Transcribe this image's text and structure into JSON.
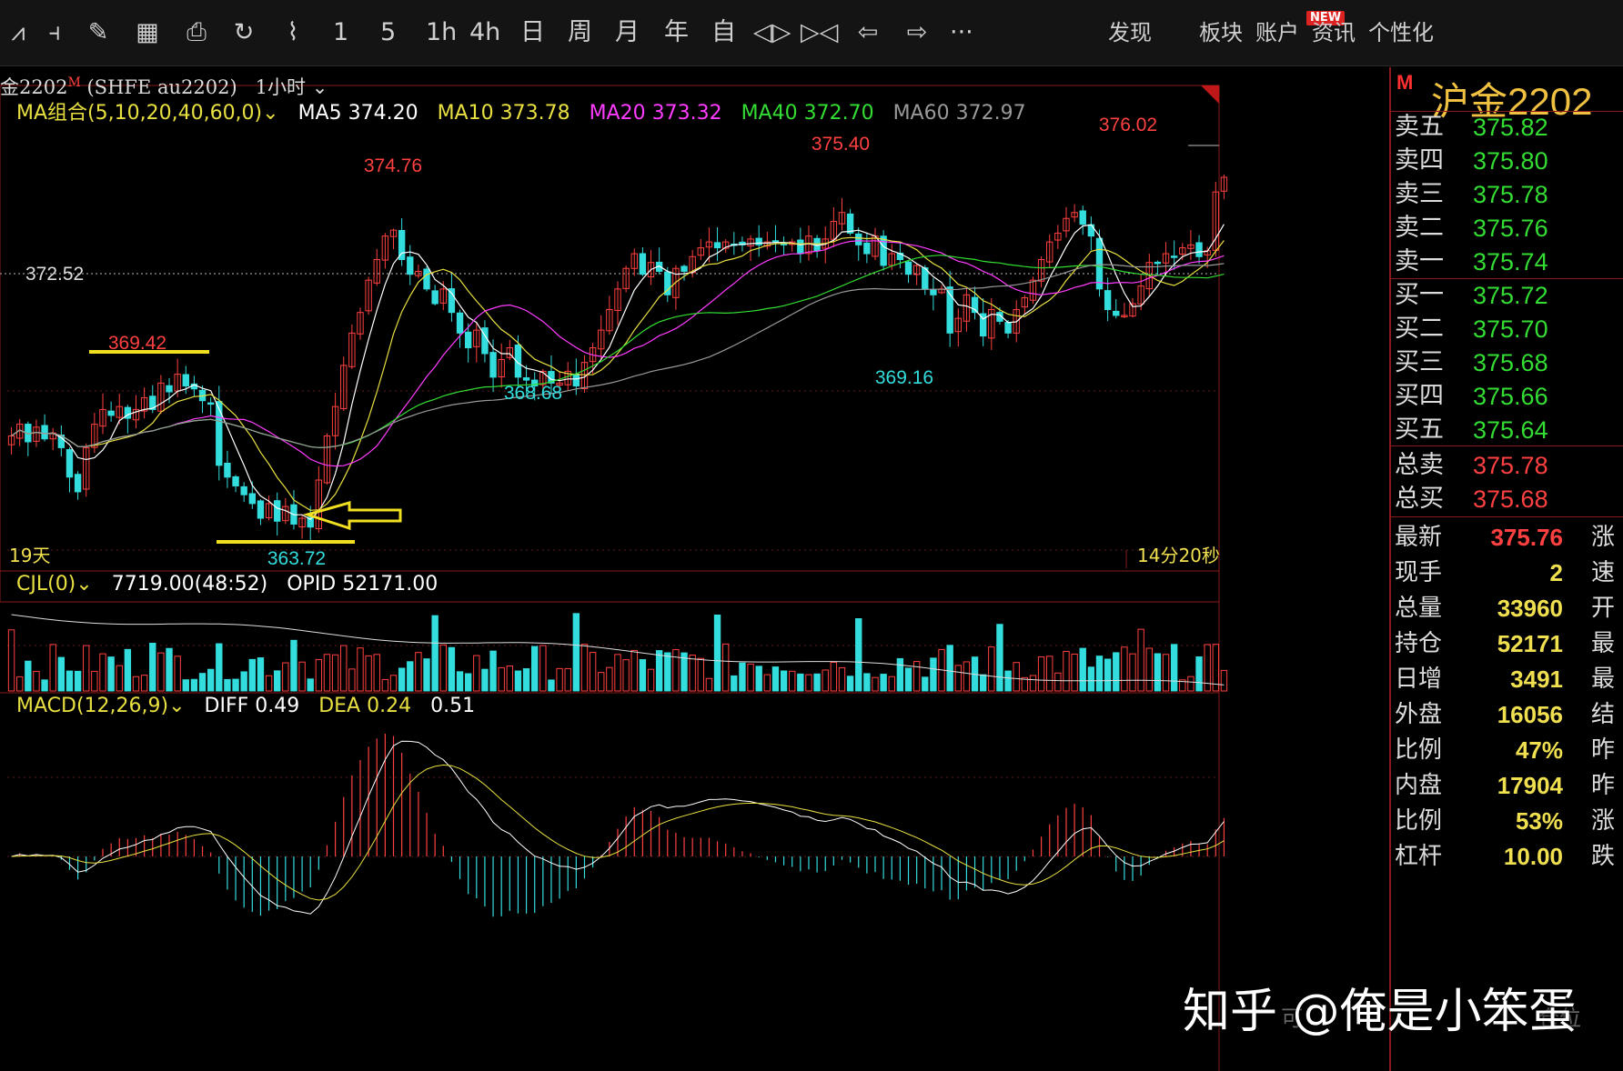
{
  "toolbar": {
    "icons": [
      "zigzag-icon",
      "candle-split-icon",
      "brush-icon",
      "ledger-icon",
      "save-icon",
      "refresh-icon",
      "draw-tool-icon"
    ],
    "periods": [
      "1",
      "5",
      "1h",
      "4h",
      "日",
      "周",
      "月",
      "年",
      "自"
    ],
    "nav_icons": [
      "shrink-icon",
      "expand-icon",
      "back-arrow-icon",
      "forward-arrow-icon"
    ],
    "more": "···",
    "right": {
      "discover": "发现",
      "new_badge": "NEW",
      "sector": "板块",
      "account": "账户",
      "news": "资讯",
      "personal": "个性化"
    }
  },
  "symbol_bar": {
    "code": "金2202",
    "flag": "M",
    "exchange": "(SHFE  au2202)",
    "period": "1小时",
    "chevron": "⌄"
  },
  "ma": {
    "label": "MA组合(5,10,20,40,60,0)",
    "chevron": "⌄",
    "items": [
      {
        "name": "MA5",
        "value": "374.20",
        "color": "#ffffff"
      },
      {
        "name": "MA10",
        "value": "373.78",
        "color": "#e8e040"
      },
      {
        "name": "MA20",
        "value": "373.32",
        "color": "#ff3cff"
      },
      {
        "name": "MA40",
        "value": "372.70",
        "color": "#33dd33"
      },
      {
        "name": "MA60",
        "value": "372.97",
        "color": "#999999"
      }
    ]
  },
  "price_panel": {
    "ref_line_label": "372.52",
    "bottom_left": "19天",
    "bottom_right": "14分20秒",
    "annotations": [
      {
        "text": "374.76",
        "kind": "high"
      },
      {
        "text": "375.40",
        "kind": "high"
      },
      {
        "text": "376.02",
        "kind": "high"
      },
      {
        "text": "369.42",
        "kind": "high"
      },
      {
        "text": "368.68",
        "kind": "low"
      },
      {
        "text": "369.16",
        "kind": "low"
      },
      {
        "text": "363.72",
        "kind": "low"
      }
    ]
  },
  "volume_panel": {
    "label": "CJL(0)",
    "chevron": "⌄",
    "value": "7719.00(48:52)",
    "opid": "OPID 52171.00"
  },
  "macd_panel": {
    "label": "MACD(12,26,9)",
    "chevron": "⌄",
    "diff": "DIFF 0.49",
    "dea": "DEA 0.24",
    "macd": "0.51"
  },
  "chart_data": {
    "type": "candlestick",
    "symbol": "沪金2202",
    "period": "1小时",
    "ylim": [
      362.5,
      377.5
    ],
    "reference_level": 372.52,
    "ma_colors": {
      "MA5": "#ffffff",
      "MA10": "#e8e040",
      "MA20": "#ff3cff",
      "MA40": "#33dd33",
      "MA60": "#999999"
    },
    "up_color": "#ff4040",
    "down_color": "#33dddd",
    "closes": [
      367.0,
      367.4,
      366.8,
      367.3,
      366.9,
      367.1,
      366.6,
      365.6,
      365.1,
      366.6,
      367.4,
      367.9,
      367.7,
      368.0,
      367.6,
      367.9,
      368.3,
      367.9,
      368.8,
      368.5,
      369.1,
      368.7,
      368.6,
      368.2,
      368.1,
      366.0,
      365.6,
      365.3,
      365.0,
      364.7,
      364.2,
      364.7,
      364.1,
      364.6,
      364.0,
      364.2,
      363.9,
      365.5,
      367.0,
      368.0,
      369.4,
      370.5,
      371.2,
      372.3,
      373.0,
      373.8,
      374.0,
      373.0,
      372.5,
      372.6,
      372.0,
      371.5,
      372.0,
      371.2,
      370.5,
      370.0,
      370.6,
      369.8,
      369.0,
      369.6,
      370.0,
      369.0,
      368.9,
      368.7,
      369.2,
      368.8,
      368.8,
      369.2,
      368.7,
      369.5,
      370.0,
      370.6,
      371.3,
      372.0,
      372.7,
      373.2,
      372.5,
      372.9,
      372.6,
      371.8,
      372.7,
      372.6,
      373.1,
      373.4,
      373.6,
      373.4,
      373.6,
      373.5,
      373.5,
      373.7,
      373.5,
      373.6,
      373.6,
      373.5,
      373.6,
      373.2,
      373.8,
      373.3,
      373.7,
      374.3,
      374.6,
      373.9,
      373.5,
      373.2,
      373.8,
      372.8,
      373.2,
      373.0,
      372.5,
      372.8,
      372.0,
      371.8,
      372.0,
      370.5,
      371.0,
      371.8,
      371.2,
      370.4,
      371.3,
      370.9,
      370.5,
      371.3,
      371.7,
      372.3,
      373.0,
      373.6,
      373.9,
      374.4,
      374.6,
      374.2,
      373.8,
      372.0,
      371.3,
      371.1,
      371.1,
      371.5,
      372.1,
      372.9,
      372.9,
      373.2,
      373.1,
      373.4,
      373.5,
      373.1,
      373.3,
      375.3,
      375.8
    ],
    "notable_prices": [
      {
        "label": "374.76",
        "type": "high"
      },
      {
        "label": "375.40",
        "type": "high"
      },
      {
        "label": "376.02",
        "type": "high"
      },
      {
        "label": "369.42",
        "type": "high"
      },
      {
        "label": "368.68",
        "type": "low"
      },
      {
        "label": "369.16",
        "type": "low"
      },
      {
        "label": "363.72",
        "type": "low"
      }
    ]
  },
  "right_panel": {
    "flag": "M",
    "title": "沪金2202",
    "asks": [
      {
        "label": "卖五",
        "price": "375.82"
      },
      {
        "label": "卖四",
        "price": "375.80"
      },
      {
        "label": "卖三",
        "price": "375.78"
      },
      {
        "label": "卖二",
        "price": "375.76"
      },
      {
        "label": "卖一",
        "price": "375.74"
      }
    ],
    "bids": [
      {
        "label": "买一",
        "price": "375.72"
      },
      {
        "label": "买二",
        "price": "375.70"
      },
      {
        "label": "买三",
        "price": "375.68"
      },
      {
        "label": "买四",
        "price": "375.66"
      },
      {
        "label": "买五",
        "price": "375.64"
      }
    ],
    "totals": [
      {
        "label": "总卖",
        "value": "375.78"
      },
      {
        "label": "总买",
        "value": "375.68"
      }
    ],
    "stats": [
      {
        "label": "最新",
        "value": "375.76",
        "red": true,
        "right": "涨"
      },
      {
        "label": "现手",
        "value": "2",
        "red": false,
        "right": "速"
      },
      {
        "label": "总量",
        "value": "33960",
        "red": false,
        "right": "开"
      },
      {
        "label": "持仓",
        "value": "52171",
        "red": false,
        "right": "最"
      },
      {
        "label": "日增",
        "value": "3491",
        "red": false,
        "right": "最"
      },
      {
        "label": "外盘",
        "value": "16056",
        "red": false,
        "right": "结"
      },
      {
        "label": "比例",
        "value": "47%",
        "red": false,
        "right": "昨"
      },
      {
        "label": "内盘",
        "value": "17904",
        "red": false,
        "right": "昨"
      },
      {
        "label": "比例",
        "value": "53%",
        "red": false,
        "right": "涨"
      },
      {
        "label": "杠杆",
        "value": "10.00",
        "red": false,
        "right": "跌"
      }
    ]
  },
  "watermark": "知乎 @俺是小笨蛋",
  "under_watermark": [
    "可",
    "仓位"
  ]
}
